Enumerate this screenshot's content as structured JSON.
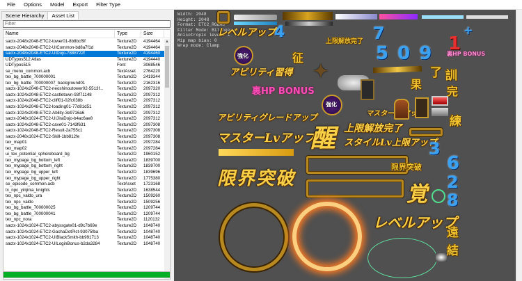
{
  "menu": [
    "File",
    "Options",
    "Model",
    "Export",
    "Filter Type"
  ],
  "tabs": [
    "Scene Hierarchy",
    "Asset List"
  ],
  "filter_placeholder": "Filter",
  "columns": [
    "Name",
    "Type",
    "Size"
  ],
  "rows": [
    [
      "sactx-2048x2048-ETC2-tower01-8b8bcf9f",
      "Texture2D",
      "4194464"
    ],
    [
      "sactx-2048x2048-ETC2-UICommon-bd8a7f1d",
      "Texture2D",
      "4194464"
    ],
    [
      "sactx-2048x2048-ETC2-UIDojo-7888722f",
      "Texture2D",
      "4194460"
    ],
    [
      "UDTypos512 Atlas",
      "Texture2D",
      "4194440"
    ],
    [
      "UDTypos515",
      "Font",
      "3068546"
    ],
    [
      "se_menu_common.acb",
      "TextAsset",
      "2764220"
    ],
    [
      "tex_bg_battle_700000001",
      "Texture2D",
      "2419344"
    ],
    [
      "tex_bg_battle_700000007_background01",
      "Texture2D",
      "2162316"
    ],
    [
      "sactx-1024x2048-ETC2-neoshinoutower02-5513f...",
      "Texture2D",
      "2097320"
    ],
    [
      "sactx-1024x2048-ETC2-castletown-93f71148",
      "Texture2D",
      "2097312"
    ],
    [
      "sactx-1024x2048-ETC2-cliff01-02fc038b",
      "Texture2D",
      "2097312"
    ],
    [
      "sactx-1024x2048-ETC2-loading01-77d81d51",
      "Texture2D",
      "2097312"
    ],
    [
      "sactx-1024x2048-ETC2-Ability-3e9716a6",
      "Texture2D",
      "2097312"
    ],
    [
      "sactx-2048x1024-ETC2-UIJiraDojo-b4ac6ae8",
      "Texture2D",
      "2097312"
    ],
    [
      "sactx-1024x2048-ETC2-cave01-7143f631",
      "Texture2D",
      "2097308"
    ],
    [
      "sactx-1024x2048-ETC2-Result-2a755c1",
      "Texture2D",
      "2097308"
    ],
    [
      "sactx-2048x1024-ETC2-Skill-1bb812fe",
      "Texture2D",
      "2097308"
    ],
    [
      "tex_map01",
      "Texture2D",
      "2097284"
    ],
    [
      "tex_map02",
      "Texture2D",
      "2097284"
    ],
    [
      "ui_tex_potential_sphereboard_bg",
      "Texture2D",
      "1960152"
    ],
    [
      "tex_mypage_bg_bottom_left",
      "Texture2D",
      "1839700"
    ],
    [
      "tex_mypage_bg_bottom_right",
      "Texture2D",
      "1839700"
    ],
    [
      "tex_mypage_bg_upper_left",
      "Texture2D",
      "1839696"
    ],
    [
      "tex_mypage_bg_upper_right",
      "Texture2D",
      "1775380"
    ],
    [
      "se_episode_common.acb",
      "TextAsset",
      "1723168"
    ],
    [
      "tx_npc_yinjinia_knights",
      "Texture2D",
      "1638544"
    ],
    [
      "tex_npc_valdo_ura",
      "Texture2D",
      "1509260"
    ],
    [
      "tex_npc_valdo",
      "Texture2D",
      "1509256"
    ],
    [
      "tex_bg_battle_700000025",
      "Texture2D",
      "1209744"
    ],
    [
      "tex_bg_battle_700000041",
      "Texture2D",
      "1209744"
    ],
    [
      "tex_npc_nora",
      "Texture2D",
      "1120132"
    ],
    [
      "sactx-1024x1024-ETC2-abyssgate01-d9c7b69e",
      "Texture2D",
      "1048740"
    ],
    [
      "sactx-1024x1024-ETC2-GachaDotPict-93075fba",
      "Texture2D",
      "1048740"
    ],
    [
      "sactx-1024x1024-ETC2-UIBlackSmith-bb991713",
      "Texture2D",
      "1048740"
    ],
    [
      "sactx-1024x1024-ETC2-UILoginBonus-b2da3284",
      "Texture2D",
      "1048740"
    ]
  ],
  "selected_row": 2,
  "progress_percent": 100,
  "texture_info": [
    "Width: 2048",
    "Height: 2048",
    "Format: ETC2_RGBA8",
    "Filter Mode: Bilinear",
    "Anisotropic level: 1",
    "Mip map bias: 0",
    "Wrap mode: Clamp"
  ],
  "atlas_text": {
    "levelup_small": "レベルアップ",
    "num_4": "4",
    "num_7": "7",
    "num_1": "1",
    "plus": "+",
    "limit_release_small": "上限解放完了",
    "sei": "征",
    "ability_learn": "アビリティ習得",
    "kyouka": "強化",
    "num_509": "5 0 9",
    "hp_bonus_small": "裏HP BONUS",
    "ryo": "了",
    "kun": "訓",
    "ura_hp_bonus": "裏HP BONUS",
    "ka": "果",
    "kan": "完",
    "ability_grade_up": "アビリティグレードアップ",
    "kyouka2": "強化",
    "master_lvup_small": "マスターLvアップ",
    "ren": "練",
    "master_lvup": "マスターLvアップ",
    "kaku_big": "醒",
    "limit_release": "上限解放完了",
    "style_lv_limit": "スタイルLv上限アップ",
    "num_3": "3",
    "num_6": "6",
    "genkai_toppa_small": "限界突破",
    "genkai_toppa": "限界突破",
    "kaku2": "覚",
    "num_2": "2",
    "num_8": "8",
    "levelup_big": "レベルアップ",
    "en": "遠",
    "ketsu": "結"
  }
}
